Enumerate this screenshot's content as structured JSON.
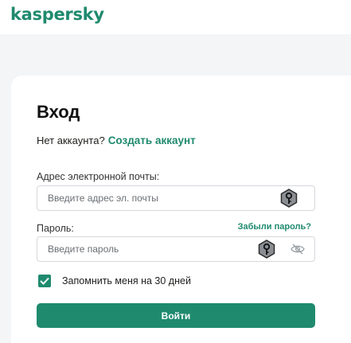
{
  "brand": {
    "logo_text": "kaspersky",
    "accent_color": "#1f8a6e"
  },
  "login": {
    "title": "Вход",
    "no_account_text": "Нет аккаунта?",
    "create_account_link": "Создать аккаунт",
    "email": {
      "label": "Адрес электронной почты:",
      "placeholder": "Введите адрес эл. почты",
      "value": "",
      "icon": "password-manager-key-icon"
    },
    "password": {
      "label": "Пароль:",
      "forgot_link": "Забыли пароль?",
      "placeholder": "Введите пароль",
      "value": "",
      "icon": "password-manager-key-icon",
      "visibility_icon": "eye-slash-icon"
    },
    "remember": {
      "label": "Запомнить меня на 30 дней",
      "checked": true
    },
    "submit_label": "Войти"
  }
}
